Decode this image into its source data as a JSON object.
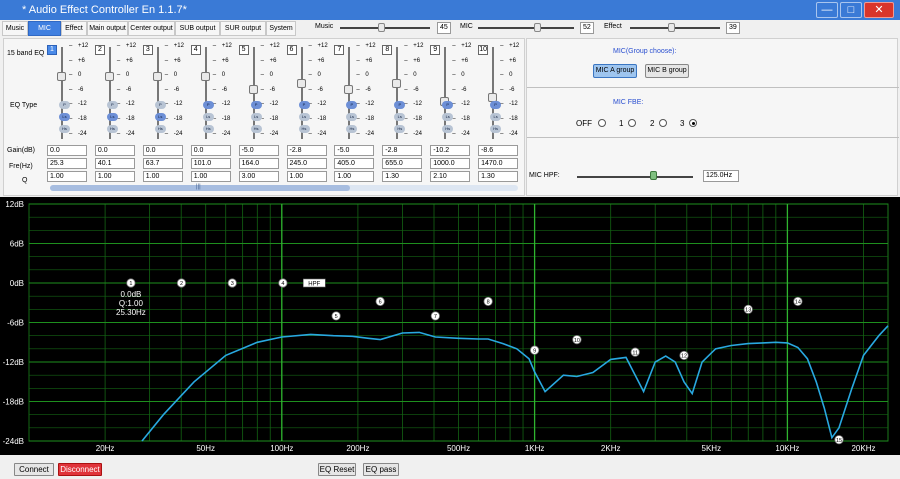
{
  "app": {
    "title": "* Audio Effect Controller En 1.1.7*",
    "min": "—",
    "max": "□",
    "close": "✕"
  },
  "tabs": [
    "Music",
    "MIC",
    "Effect",
    "Main output",
    "Center output",
    "SUB output",
    "SUR output",
    "System"
  ],
  "top_sliders": [
    {
      "label": "Music",
      "value": "45",
      "level": 0.45
    },
    {
      "label": "MIC",
      "value": "52",
      "level": 0.52
    },
    {
      "label": "Effect",
      "value": "39",
      "level": 0.39
    }
  ],
  "eq": {
    "title": "15 band EQ",
    "eq_type_label": "EQ Type",
    "gain_label": "Gain(dB)",
    "freq_label": "Fre(Hz)",
    "q_label": "Q",
    "scale": [
      "+12",
      "+6",
      "0",
      "-6",
      "-12",
      "-18",
      "-24"
    ],
    "type_icons": [
      "P",
      "Ls",
      "Hs"
    ],
    "bands": [
      {
        "num": "1",
        "gain": "0.0",
        "freq": "25.3",
        "q": "1.00",
        "active": true,
        "type": "Ls"
      },
      {
        "num": "2",
        "gain": "0.0",
        "freq": "40.1",
        "q": "1.00",
        "active": false,
        "type": "Ls"
      },
      {
        "num": "3",
        "gain": "0.0",
        "freq": "63.7",
        "q": "1.00",
        "active": false,
        "type": "Ls"
      },
      {
        "num": "4",
        "gain": "0.0",
        "freq": "101.0",
        "q": "1.00",
        "active": false,
        "type": "P"
      },
      {
        "num": "5",
        "gain": "-5.0",
        "freq": "164.0",
        "q": "3.00",
        "active": false,
        "type": "P"
      },
      {
        "num": "6",
        "gain": "-2.8",
        "freq": "245.0",
        "q": "1.00",
        "active": false,
        "type": "P"
      },
      {
        "num": "7",
        "gain": "-5.0",
        "freq": "405.0",
        "q": "1.00",
        "active": false,
        "type": "P"
      },
      {
        "num": "8",
        "gain": "-2.8",
        "freq": "655.0",
        "q": "1.30",
        "active": false,
        "type": "P"
      },
      {
        "num": "9",
        "gain": "-10.2",
        "freq": "1000.0",
        "q": "2.10",
        "active": false,
        "type": "P"
      },
      {
        "num": "10",
        "gain": "-8.6",
        "freq": "1470.0",
        "q": "1.30",
        "active": false,
        "type": "P"
      }
    ],
    "scroll_icon": "|||"
  },
  "right": {
    "group_title": "MIC(Group choose):",
    "group_a": "MIC A group",
    "group_b": "MIC B group",
    "fbe_title": "MIC FBE:",
    "fbe_options": [
      "OFF",
      "1",
      "2",
      "3"
    ],
    "fbe_selected": "3",
    "hpf_label": "MIC HPF:",
    "hpf_value": "125.0Hz",
    "hpf_level": 0.46
  },
  "chart_data": {
    "type": "line",
    "title": "",
    "xlabel": "",
    "ylabel": "",
    "ylim": [
      -24,
      12
    ],
    "xlim": [
      10,
      25000
    ],
    "x_scale": "log",
    "y_ticks": [
      "12dB",
      "6dB",
      "0dB",
      "-6dB",
      "-12dB",
      "-18dB",
      "-24dB"
    ],
    "x_ticks": [
      "20Hz",
      "50Hz",
      "100Hz",
      "200Hz",
      "500Hz",
      "1KHz",
      "2KHz",
      "5KHz",
      "10KHz",
      "20KHz"
    ],
    "x_tick_values": [
      20,
      50,
      100,
      200,
      500,
      1000,
      2000,
      5000,
      10000,
      20000
    ],
    "series": [
      {
        "color": "#29a8e0",
        "x": [
          28,
          34,
          45,
          60,
          80,
          100,
          130,
          160,
          190,
          220,
          245,
          300,
          350,
          405,
          500,
          600,
          655,
          750,
          850,
          950,
          1000,
          1100,
          1300,
          1470,
          1700,
          2000,
          2300,
          2500,
          2700,
          3000,
          3300,
          3600,
          3900,
          4200,
          4600,
          5200,
          6000,
          7000,
          8000,
          9000,
          10000,
          11000,
          12000,
          13000,
          14000,
          15000,
          16000,
          18000,
          20000,
          23000,
          25000
        ],
        "y": [
          -24,
          -20,
          -15,
          -11,
          -9,
          -8.2,
          -7.8,
          -8.0,
          -8.1,
          -8.4,
          -8.6,
          -7.6,
          -7.5,
          -8.2,
          -8.4,
          -8.5,
          -8.5,
          -9.2,
          -10,
          -11.5,
          -13.5,
          -16.5,
          -14,
          -14.2,
          -13.6,
          -11.6,
          -11.3,
          -14,
          -16.5,
          -12,
          -11.1,
          -12,
          -15,
          -16.8,
          -12,
          -10,
          -9.5,
          -9.2,
          -9.1,
          -9.0,
          -9.1,
          -9.8,
          -11.5,
          -15,
          -19,
          -23.5,
          -22,
          -16,
          -11,
          -8,
          -6.5
        ]
      }
    ],
    "markers": [
      {
        "label": "1",
        "x": 25.3,
        "y": 0
      },
      {
        "label": "2",
        "x": 40.1,
        "y": 0
      },
      {
        "label": "3",
        "x": 63.7,
        "y": 0
      },
      {
        "label": "4",
        "x": 101,
        "y": 0
      },
      {
        "label": "5",
        "x": 164,
        "y": -5
      },
      {
        "label": "6",
        "x": 245,
        "y": -2.8
      },
      {
        "label": "7",
        "x": 405,
        "y": -5
      },
      {
        "label": "8",
        "x": 655,
        "y": -2.8
      },
      {
        "label": "9",
        "x": 1000,
        "y": -10.2
      },
      {
        "label": "10",
        "x": 1470,
        "y": -8.6
      },
      {
        "label": "11",
        "x": 2500,
        "y": -10.5
      },
      {
        "label": "12",
        "x": 3900,
        "y": -11
      },
      {
        "label": "13",
        "x": 7000,
        "y": -4
      },
      {
        "label": "14",
        "x": 11000,
        "y": -2.8
      },
      {
        "label": "15",
        "x": 16000,
        "y": -23.8
      }
    ],
    "hpf_tag": {
      "label": "HPF",
      "x": 125,
      "y": 0
    },
    "info": [
      "0.0dB",
      "Q:1.00",
      "25.30Hz"
    ]
  },
  "bottom": {
    "connect": "Connect",
    "disconnect": "Disconnect",
    "eq_reset": "EQ Reset",
    "eq_pass": "EQ pass"
  }
}
